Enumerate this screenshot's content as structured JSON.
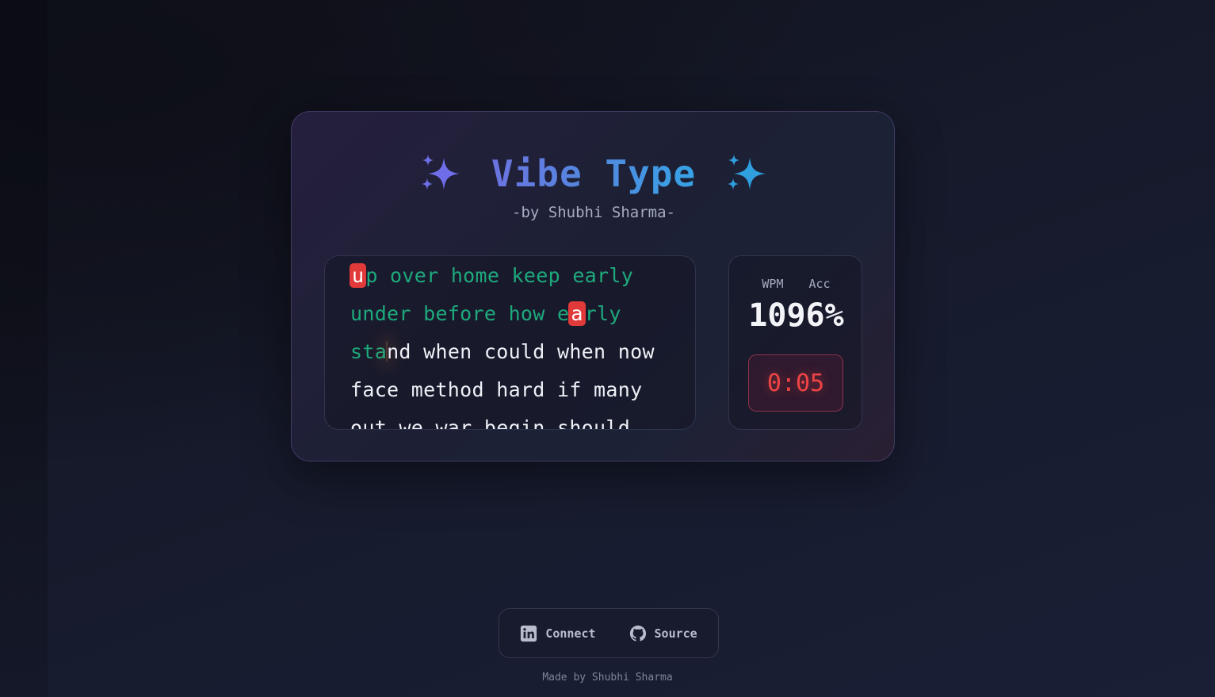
{
  "app": {
    "title": "Vibe Type",
    "subtitle": "-by Shubhi Sharma-"
  },
  "typing": {
    "lines": [
      [
        {
          "t": "u",
          "s": "err"
        },
        {
          "t": "p over home keep early",
          "s": "ok"
        }
      ],
      [
        {
          "t": "under before how e",
          "s": "ok"
        },
        {
          "t": "a",
          "s": "err"
        },
        {
          "t": "rly",
          "s": "ok"
        }
      ],
      [
        {
          "t": "sta",
          "s": "ok"
        },
        {
          "t": "",
          "s": "cursor"
        },
        {
          "t": "nd when could when now",
          "s": "todo"
        }
      ],
      [
        {
          "t": "face method hard if many",
          "s": "todo"
        }
      ],
      [
        {
          "t": "out we war begin should",
          "s": "todo"
        }
      ]
    ]
  },
  "stats": {
    "wpm_label": "WPM",
    "acc_label": "Acc",
    "value_display": "1096%",
    "timer": "0:05"
  },
  "footer": {
    "connect_label": "Connect",
    "connect_icon": "linkedin-icon",
    "source_label": "Source",
    "source_icon": "github-icon",
    "made_by": "Made by Shubhi Sharma"
  },
  "colors": {
    "correct": "#1ea97c",
    "error": "#e03a3a",
    "pending": "#eef0f6",
    "timer": "#ef4444"
  }
}
